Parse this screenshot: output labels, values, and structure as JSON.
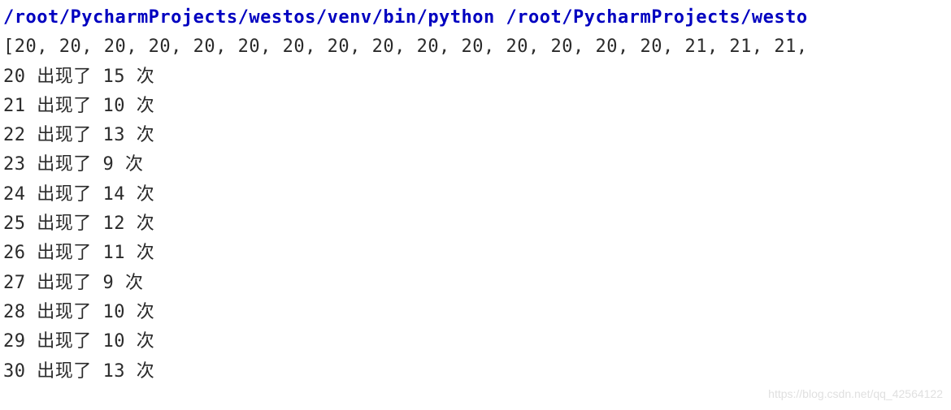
{
  "console": {
    "command": "/root/PycharmProjects/westos/venv/bin/python /root/PycharmProjects/westo",
    "list_output": "[20, 20, 20, 20, 20, 20, 20, 20, 20, 20, 20, 20, 20, 20, 20, 21, 21, 21,",
    "counts": [
      {
        "num": "20",
        "label": " 出现了",
        "count": " 15",
        "suffix": " 次"
      },
      {
        "num": "21",
        "label": " 出现了",
        "count": " 10",
        "suffix": " 次"
      },
      {
        "num": "22",
        "label": " 出现了",
        "count": " 13",
        "suffix": " 次"
      },
      {
        "num": "23",
        "label": " 出现了",
        "count": " 9",
        "suffix": " 次"
      },
      {
        "num": "24",
        "label": " 出现了",
        "count": " 14",
        "suffix": " 次"
      },
      {
        "num": "25",
        "label": " 出现了",
        "count": " 12",
        "suffix": " 次"
      },
      {
        "num": "26",
        "label": " 出现了",
        "count": " 11",
        "suffix": " 次"
      },
      {
        "num": "27",
        "label": " 出现了",
        "count": " 9",
        "suffix": " 次"
      },
      {
        "num": "28",
        "label": " 出现了",
        "count": " 10",
        "suffix": " 次"
      },
      {
        "num": "29",
        "label": " 出现了",
        "count": " 10",
        "suffix": " 次"
      },
      {
        "num": "30",
        "label": " 出现了",
        "count": " 13",
        "suffix": " 次"
      }
    ]
  },
  "watermark": "https://blog.csdn.net/qq_42564122"
}
